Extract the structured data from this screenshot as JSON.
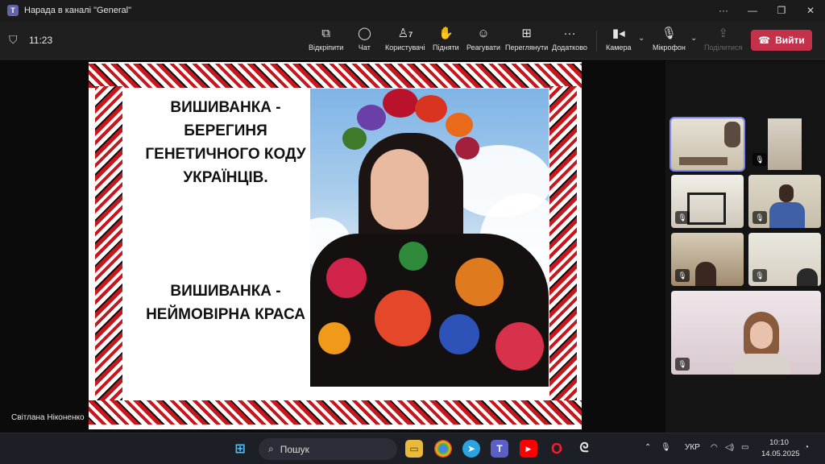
{
  "window": {
    "title": "Нарада в каналі \"General\"",
    "more": "···",
    "minimize": "—",
    "maximize": "❐",
    "close": "✕"
  },
  "meeting": {
    "timer": "11:23",
    "buttons": {
      "unpin": "Відкріпити",
      "chat": "Чат",
      "people": "Користувачі",
      "people_count": "7",
      "raise": "Підняти",
      "react": "Реагувати",
      "view": "Переглянути",
      "more": "Додатково",
      "camera": "Камера",
      "mic": "Мікрофон",
      "share": "Поділитися",
      "leave": "Вийти"
    }
  },
  "slide": {
    "heading1": "ВИШИВАНКА  - БЕРЕГИНЯ ГЕНЕТИЧНОГО КОДУ УКРАЇНЦІВ.",
    "heading2": "ВИШИВАНКА - НЕЙМОВІРНА КРАСА"
  },
  "presenter_name": "Світлана Ніконенко",
  "participants": [
    {
      "id": "p1",
      "muted": true,
      "selected": true
    },
    {
      "id": "p2",
      "muted": true,
      "selected": false
    },
    {
      "id": "p3",
      "muted": true,
      "selected": false
    },
    {
      "id": "p4",
      "muted": true,
      "selected": false
    },
    {
      "id": "p5",
      "muted": true,
      "selected": false
    },
    {
      "id": "p6",
      "muted": true,
      "selected": false
    },
    {
      "id": "p7",
      "muted": true,
      "selected": false
    }
  ],
  "taskbar": {
    "search_placeholder": "Пошук",
    "lang": "УКР",
    "time": "10:10",
    "date": "14.05.2025"
  },
  "colors": {
    "accent": "#6264a7",
    "leave": "#c4314b",
    "selection": "#7f85f5",
    "ornament_red": "#c8161d"
  }
}
